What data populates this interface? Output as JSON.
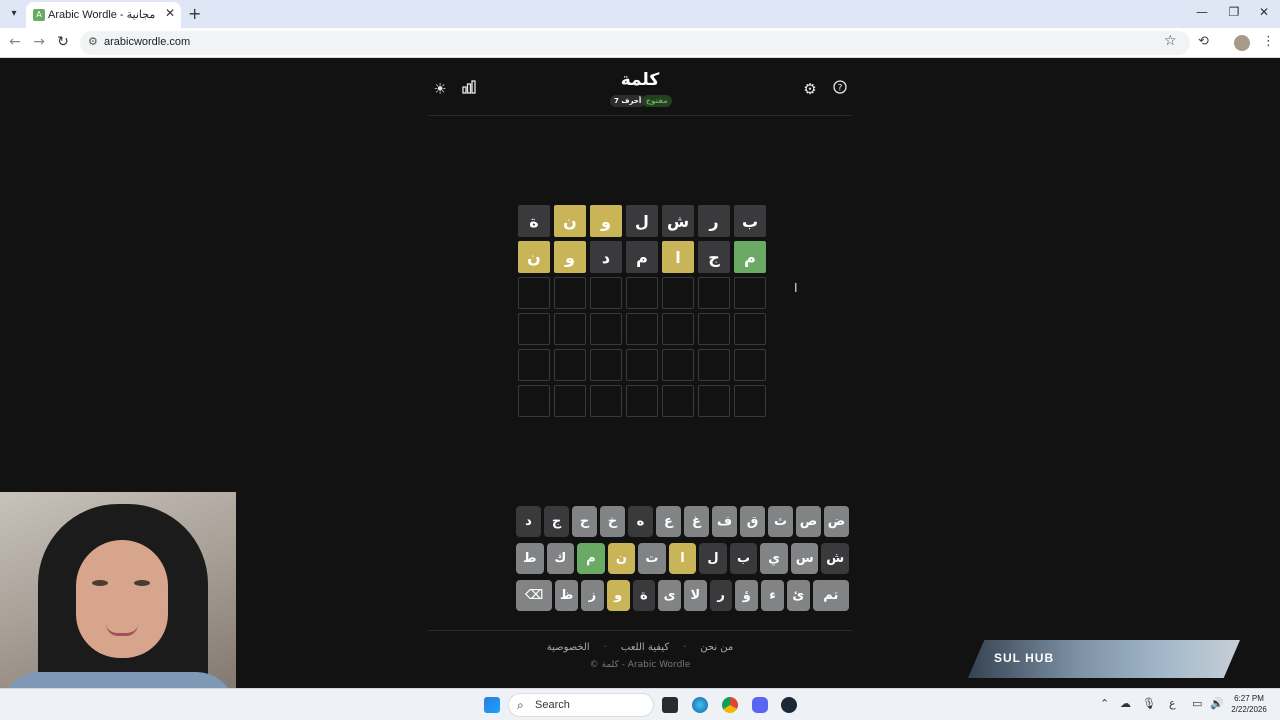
{
  "browser": {
    "tab_title": "Arabic Wordle - عربية مجانية",
    "tab_favicon": "A",
    "url": "arabicwordle.com",
    "icons": [
      "tab-search-icon",
      "close-icon",
      "new-tab-icon",
      "minimize-icon",
      "restore-icon",
      "window-close-icon",
      "back-icon",
      "forward-icon",
      "reload-icon",
      "site-info-icon",
      "star-icon",
      "history-icon",
      "profile-icon",
      "menu-icon"
    ]
  },
  "header": {
    "title": "كلمة",
    "badge_length": "7 أحرف",
    "badge_mode": "مفتوح",
    "icons": [
      "theme-toggle-icon",
      "stats-icon",
      "settings-icon",
      "help-icon"
    ]
  },
  "board": {
    "rows": [
      [
        {
          "letter": "ب",
          "state": "absent"
        },
        {
          "letter": "ر",
          "state": "absent"
        },
        {
          "letter": "ش",
          "state": "absent"
        },
        {
          "letter": "ل",
          "state": "absent"
        },
        {
          "letter": "و",
          "state": "present"
        },
        {
          "letter": "ن",
          "state": "present"
        },
        {
          "letter": "ة",
          "state": "absent"
        }
      ],
      [
        {
          "letter": "م",
          "state": "correct"
        },
        {
          "letter": "ج",
          "state": "absent"
        },
        {
          "letter": "ا",
          "state": "present"
        },
        {
          "letter": "م",
          "state": "absent"
        },
        {
          "letter": "د",
          "state": "absent"
        },
        {
          "letter": "و",
          "state": "present"
        },
        {
          "letter": "ن",
          "state": "present"
        }
      ],
      [
        {
          "letter": "",
          "state": "empty"
        },
        {
          "letter": "",
          "state": "empty"
        },
        {
          "letter": "",
          "state": "empty"
        },
        {
          "letter": "",
          "state": "empty"
        },
        {
          "letter": "",
          "state": "empty"
        },
        {
          "letter": "",
          "state": "empty"
        },
        {
          "letter": "",
          "state": "empty"
        }
      ],
      [
        {
          "letter": "",
          "state": "empty"
        },
        {
          "letter": "",
          "state": "empty"
        },
        {
          "letter": "",
          "state": "empty"
        },
        {
          "letter": "",
          "state": "empty"
        },
        {
          "letter": "",
          "state": "empty"
        },
        {
          "letter": "",
          "state": "empty"
        },
        {
          "letter": "",
          "state": "empty"
        }
      ],
      [
        {
          "letter": "",
          "state": "empty"
        },
        {
          "letter": "",
          "state": "empty"
        },
        {
          "letter": "",
          "state": "empty"
        },
        {
          "letter": "",
          "state": "empty"
        },
        {
          "letter": "",
          "state": "empty"
        },
        {
          "letter": "",
          "state": "empty"
        },
        {
          "letter": "",
          "state": "empty"
        }
      ],
      [
        {
          "letter": "",
          "state": "empty"
        },
        {
          "letter": "",
          "state": "empty"
        },
        {
          "letter": "",
          "state": "empty"
        },
        {
          "letter": "",
          "state": "empty"
        },
        {
          "letter": "",
          "state": "empty"
        },
        {
          "letter": "",
          "state": "empty"
        },
        {
          "letter": "",
          "state": "empty"
        }
      ]
    ]
  },
  "keyboard": {
    "rows": [
      [
        {
          "label": "ض",
          "state": "default"
        },
        {
          "label": "ص",
          "state": "default"
        },
        {
          "label": "ث",
          "state": "default"
        },
        {
          "label": "ق",
          "state": "default"
        },
        {
          "label": "ف",
          "state": "default"
        },
        {
          "label": "غ",
          "state": "default"
        },
        {
          "label": "ع",
          "state": "default"
        },
        {
          "label": "ه",
          "state": "absent"
        },
        {
          "label": "خ",
          "state": "default"
        },
        {
          "label": "ح",
          "state": "default"
        },
        {
          "label": "ج",
          "state": "absent"
        },
        {
          "label": "د",
          "state": "absent"
        }
      ],
      [
        {
          "label": "ش",
          "state": "absent"
        },
        {
          "label": "س",
          "state": "default"
        },
        {
          "label": "ي",
          "state": "default"
        },
        {
          "label": "ب",
          "state": "absent"
        },
        {
          "label": "ل",
          "state": "absent"
        },
        {
          "label": "ا",
          "state": "present"
        },
        {
          "label": "ت",
          "state": "default"
        },
        {
          "label": "ن",
          "state": "present"
        },
        {
          "label": "م",
          "state": "correct"
        },
        {
          "label": "ك",
          "state": "default"
        },
        {
          "label": "ط",
          "state": "default"
        }
      ],
      [
        {
          "label": "تم",
          "state": "default",
          "wide": true
        },
        {
          "label": "ئ",
          "state": "default"
        },
        {
          "label": "ء",
          "state": "default"
        },
        {
          "label": "ؤ",
          "state": "default"
        },
        {
          "label": "ر",
          "state": "absent"
        },
        {
          "label": "لا",
          "state": "default"
        },
        {
          "label": "ى",
          "state": "default"
        },
        {
          "label": "ة",
          "state": "absent"
        },
        {
          "label": "و",
          "state": "present"
        },
        {
          "label": "ز",
          "state": "default"
        },
        {
          "label": "ظ",
          "state": "default"
        },
        {
          "label": "⌫",
          "state": "default",
          "wide": true
        }
      ]
    ]
  },
  "footer": {
    "link_about": "من نحن",
    "link_howto": "كيفية اللعب",
    "link_privacy": "الخصوصية",
    "copyright": "© كلمة - Arabic Wordle"
  },
  "watermark": {
    "text": "SUL HUB"
  },
  "taskbar": {
    "search_placeholder": "Search",
    "time": "6:27 PM",
    "date": "2/22/2026",
    "lang": "ع"
  },
  "colors": {
    "correct": "#6aaa64",
    "present": "#c9b458",
    "absent": "#3a3a3c",
    "background": "#121212"
  }
}
